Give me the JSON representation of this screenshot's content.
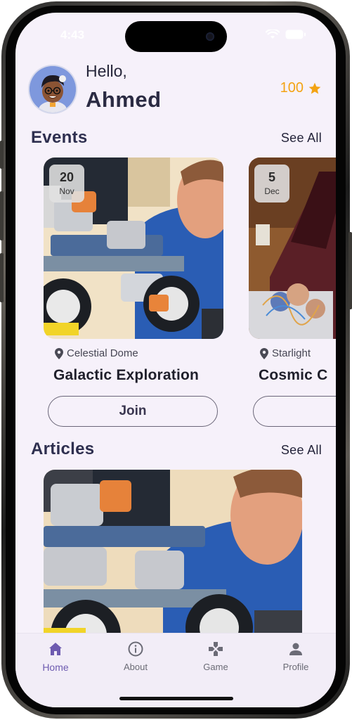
{
  "status_bar": {
    "time": "4:43"
  },
  "header": {
    "greeting": "Hello,",
    "user_name": "Ahmed",
    "points": "100",
    "point_icon": "star-icon"
  },
  "events_section": {
    "title": "Events",
    "see_all_label": "See All",
    "items": [
      {
        "day": "20",
        "month": "Nov",
        "location": "Celestial Dome",
        "title": "Galactic Exploration",
        "join_label": "Join"
      },
      {
        "day": "5",
        "month": "Dec",
        "location": "Starlight",
        "title": "Cosmic C",
        "join_label": ""
      }
    ]
  },
  "articles_section": {
    "title": "Articles",
    "see_all_label": "See All"
  },
  "bottom_nav": {
    "items": [
      {
        "label": "Home",
        "icon": "home-icon",
        "active": true
      },
      {
        "label": "About",
        "icon": "info-icon",
        "active": false
      },
      {
        "label": "Game",
        "icon": "gamepad-icon",
        "active": false
      },
      {
        "label": "Profile",
        "icon": "person-icon",
        "active": false
      }
    ]
  },
  "colors": {
    "background": "#f6f1fa",
    "accent": "#6e5bb0",
    "points": "#f3a313",
    "heading": "#2e2f4f"
  }
}
